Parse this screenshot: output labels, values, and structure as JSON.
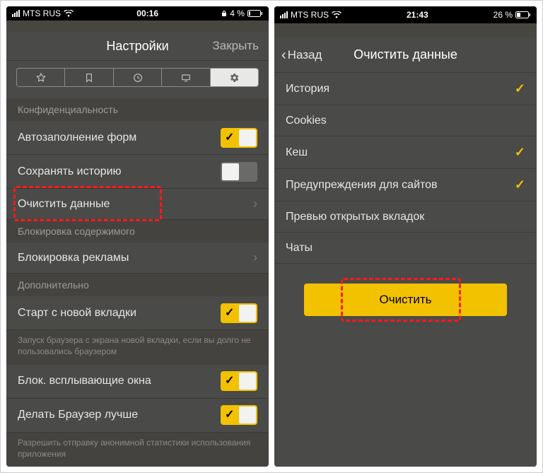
{
  "left": {
    "status": {
      "carrier": "MTS RUS",
      "time": "00:16",
      "battery": "4 %",
      "lock": true
    },
    "nav": {
      "title": "Настройки",
      "close": "Закрыть"
    },
    "tabs": [
      "star",
      "bookmark",
      "history",
      "desktop",
      "settings"
    ],
    "sec_privacy": "Конфиденциальность",
    "rows_privacy": {
      "autofill": "Автозаполнение форм",
      "save_history": "Сохранять историю",
      "clear_data": "Очистить данные"
    },
    "sec_block": "Блокировка содержимого",
    "rows_block": {
      "adblock": "Блокировка рекламы"
    },
    "sec_extra": "Дополнительно",
    "rows_extra": {
      "start_new_tab": "Старт с новой вкладки",
      "start_desc": "Запуск браузера с экрана новой вкладки, если вы долго не пользовались браузером",
      "block_popups": "Блок. всплывающие окна",
      "improve": "Делать Браузер лучше",
      "improve_desc": "Разрешить отправку анонимной статистики использования приложения"
    }
  },
  "right": {
    "status": {
      "carrier": "MTS RUS",
      "time": "21:43",
      "battery": "26 %"
    },
    "nav": {
      "back": "Назад",
      "title": "Очистить данные"
    },
    "items": {
      "history": "История",
      "cookies": "Cookies",
      "cache": "Кеш",
      "warnings": "Предупреждения для сайтов",
      "previews": "Превью открытых вкладок",
      "chats": "Чаты"
    },
    "clear_btn": "Очистить"
  }
}
